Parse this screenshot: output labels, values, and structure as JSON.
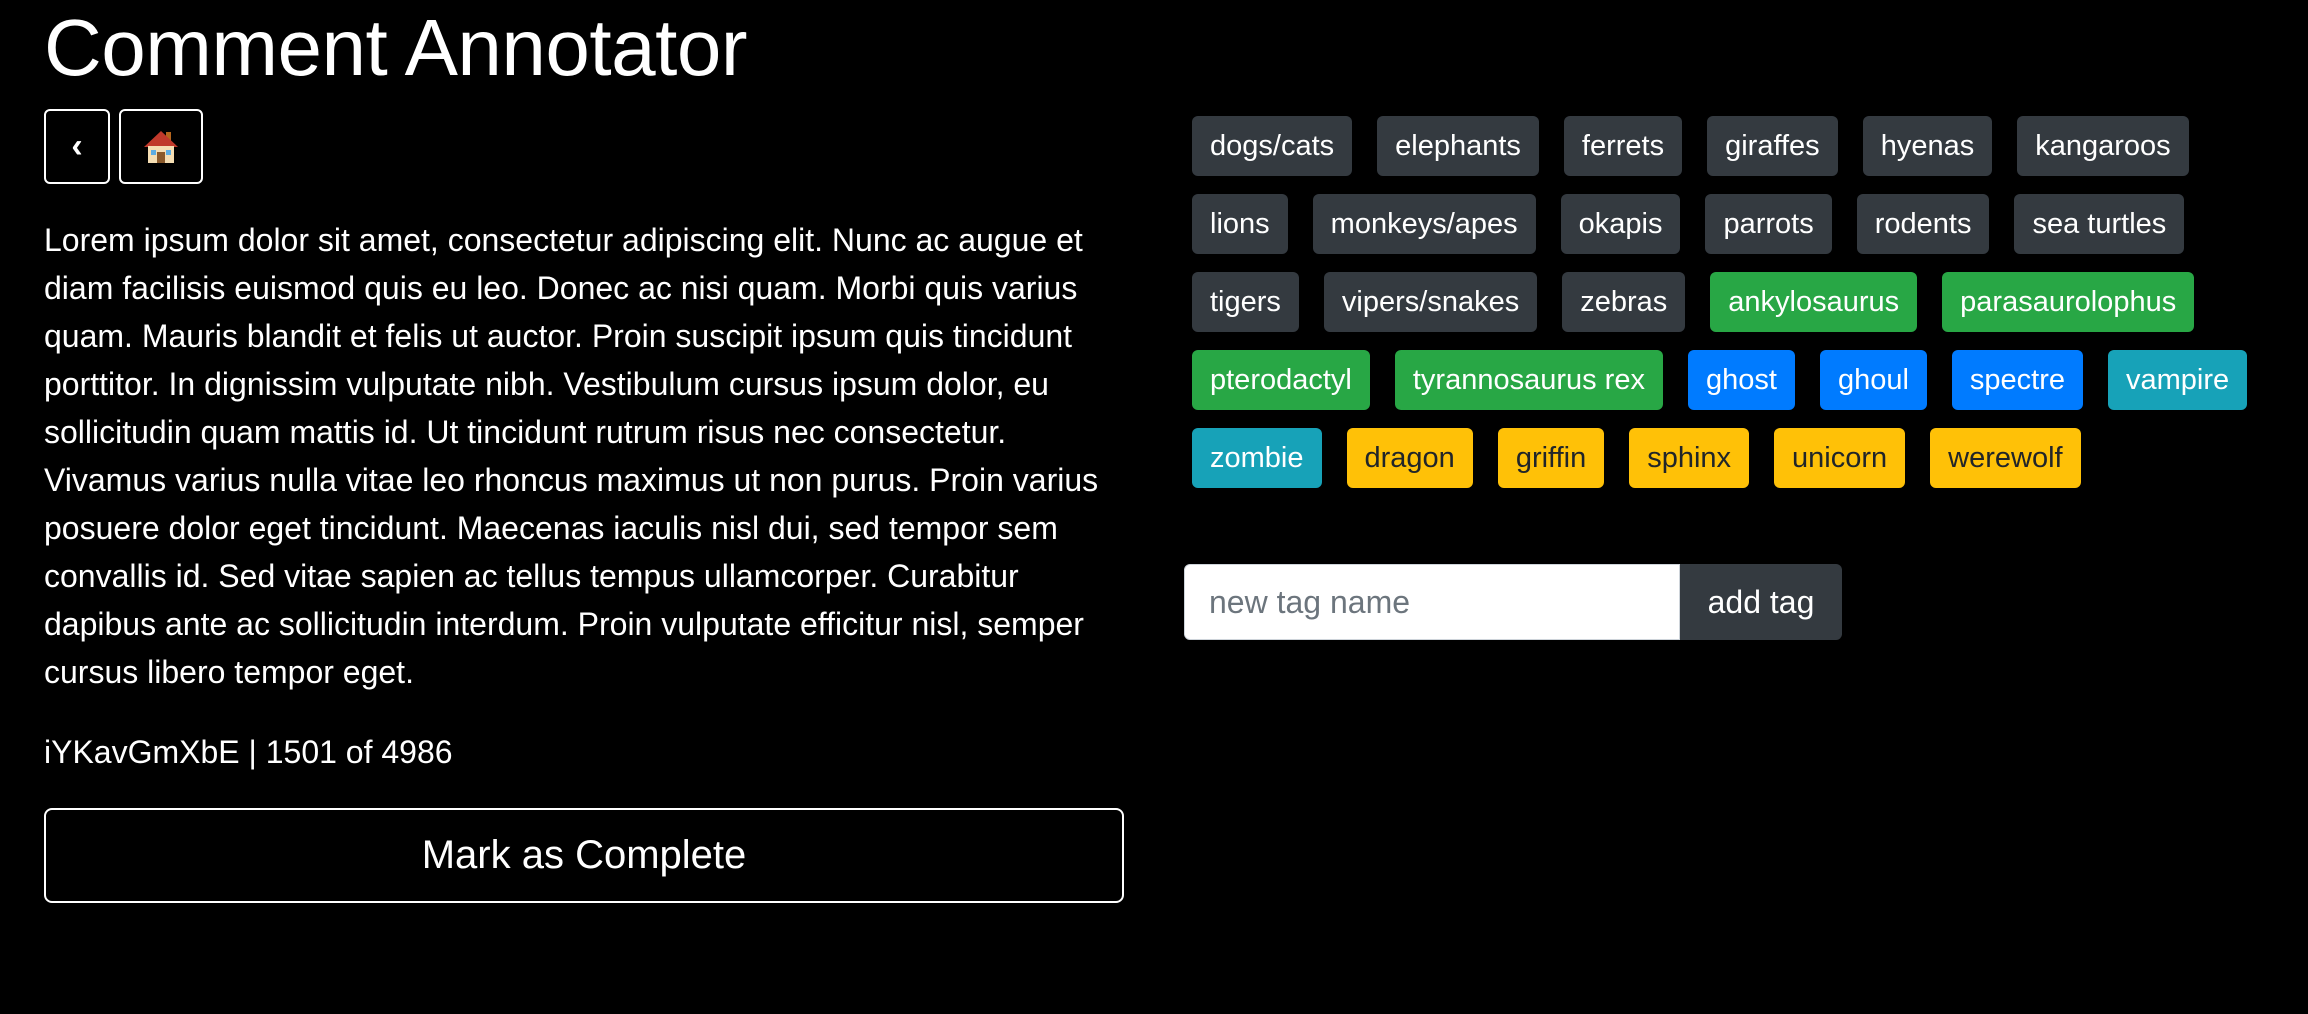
{
  "app": {
    "title": "Comment Annotator"
  },
  "nav": {
    "back_label": "‹",
    "back_icon": "chevron-left-icon",
    "home_icon": "house-icon"
  },
  "comment": {
    "text": "Lorem ipsum dolor sit amet, consectetur adipiscing elit. Nunc ac augue et diam facilisis euismod quis eu leo. Donec ac nisi quam. Morbi quis varius quam. Mauris blandit et felis ut auctor. Proin suscipit ipsum quis tincidunt porttitor. In dignissim vulputate nibh. Vestibulum cursus ipsum dolor, eu sollicitudin quam mattis id. Ut tincidunt rutrum risus nec consectetur. Vivamus varius nulla vitae leo rhoncus maximus ut non purus. Proin varius posuere dolor eget tincidunt. Maecenas iaculis nisl dui, sed tempor sem convallis id. Sed vitae sapien ac tellus tempus ullamcorper. Curabitur dapibus ante ac sollicitudin interdum. Proin vulputate efficitur nisl, semper cursus libero tempor eget.",
    "meta": "iYKavGmXbE | 1501 of 4986",
    "complete_label": "Mark as Complete"
  },
  "colors": {
    "dark": "#343a40",
    "green": "#28a745",
    "blue": "#007bff",
    "teal": "#17a2b8",
    "yellow": "#ffc107"
  },
  "tags": [
    {
      "label": "dogs/cats",
      "color": "dark"
    },
    {
      "label": "elephants",
      "color": "dark"
    },
    {
      "label": "ferrets",
      "color": "dark"
    },
    {
      "label": "giraffes",
      "color": "dark"
    },
    {
      "label": "hyenas",
      "color": "dark"
    },
    {
      "label": "kangaroos",
      "color": "dark"
    },
    {
      "label": "lions",
      "color": "dark"
    },
    {
      "label": "monkeys/apes",
      "color": "dark"
    },
    {
      "label": "okapis",
      "color": "dark"
    },
    {
      "label": "parrots",
      "color": "dark"
    },
    {
      "label": "rodents",
      "color": "dark"
    },
    {
      "label": "sea turtles",
      "color": "dark"
    },
    {
      "label": "tigers",
      "color": "dark"
    },
    {
      "label": "vipers/snakes",
      "color": "dark"
    },
    {
      "label": "zebras",
      "color": "dark"
    },
    {
      "label": "ankylosaurus",
      "color": "green"
    },
    {
      "label": "parasaurolophus",
      "color": "green"
    },
    {
      "label": "pterodactyl",
      "color": "green"
    },
    {
      "label": "tyrannosaurus rex",
      "color": "green"
    },
    {
      "label": "ghost",
      "color": "blue"
    },
    {
      "label": "ghoul",
      "color": "blue"
    },
    {
      "label": "spectre",
      "color": "blue"
    },
    {
      "label": "vampire",
      "color": "teal"
    },
    {
      "label": "zombie",
      "color": "teal"
    },
    {
      "label": "dragon",
      "color": "yellow"
    },
    {
      "label": "griffin",
      "color": "yellow"
    },
    {
      "label": "sphinx",
      "color": "yellow"
    },
    {
      "label": "unicorn",
      "color": "yellow"
    },
    {
      "label": "werewolf",
      "color": "yellow"
    }
  ],
  "add_tag": {
    "placeholder": "new tag name",
    "value": "",
    "button_label": "add tag"
  }
}
